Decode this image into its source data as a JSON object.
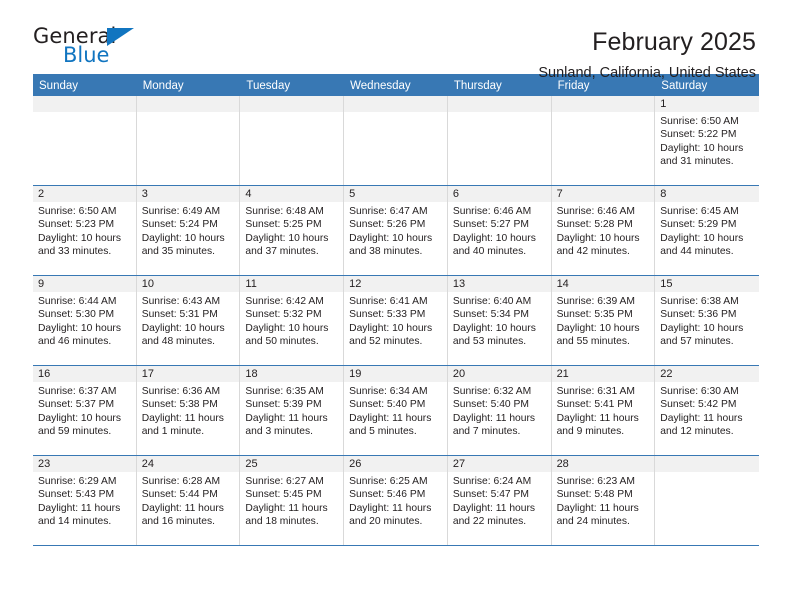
{
  "brand": {
    "name_part1": "General",
    "name_part2": "Blue",
    "triangle_color": "#1175c0"
  },
  "header": {
    "title": "February 2025",
    "subtitle": "Sunland, California, United States"
  },
  "theme": {
    "header_blue": "#3878b4",
    "day_strip_gray": "#f1f1f1",
    "text_color": "#231f20",
    "cell_border": "#d9d9d9"
  },
  "weekdays": [
    "Sunday",
    "Monday",
    "Tuesday",
    "Wednesday",
    "Thursday",
    "Friday",
    "Saturday"
  ],
  "weeks": [
    [
      {
        "day": "",
        "empty": true
      },
      {
        "day": "",
        "empty": true
      },
      {
        "day": "",
        "empty": true
      },
      {
        "day": "",
        "empty": true
      },
      {
        "day": "",
        "empty": true
      },
      {
        "day": "",
        "empty": true
      },
      {
        "day": "1",
        "sunrise": "Sunrise: 6:50 AM",
        "sunset": "Sunset: 5:22 PM",
        "daylight": "Daylight: 10 hours and 31 minutes."
      }
    ],
    [
      {
        "day": "2",
        "sunrise": "Sunrise: 6:50 AM",
        "sunset": "Sunset: 5:23 PM",
        "daylight": "Daylight: 10 hours and 33 minutes."
      },
      {
        "day": "3",
        "sunrise": "Sunrise: 6:49 AM",
        "sunset": "Sunset: 5:24 PM",
        "daylight": "Daylight: 10 hours and 35 minutes."
      },
      {
        "day": "4",
        "sunrise": "Sunrise: 6:48 AM",
        "sunset": "Sunset: 5:25 PM",
        "daylight": "Daylight: 10 hours and 37 minutes."
      },
      {
        "day": "5",
        "sunrise": "Sunrise: 6:47 AM",
        "sunset": "Sunset: 5:26 PM",
        "daylight": "Daylight: 10 hours and 38 minutes."
      },
      {
        "day": "6",
        "sunrise": "Sunrise: 6:46 AM",
        "sunset": "Sunset: 5:27 PM",
        "daylight": "Daylight: 10 hours and 40 minutes."
      },
      {
        "day": "7",
        "sunrise": "Sunrise: 6:46 AM",
        "sunset": "Sunset: 5:28 PM",
        "daylight": "Daylight: 10 hours and 42 minutes."
      },
      {
        "day": "8",
        "sunrise": "Sunrise: 6:45 AM",
        "sunset": "Sunset: 5:29 PM",
        "daylight": "Daylight: 10 hours and 44 minutes."
      }
    ],
    [
      {
        "day": "9",
        "sunrise": "Sunrise: 6:44 AM",
        "sunset": "Sunset: 5:30 PM",
        "daylight": "Daylight: 10 hours and 46 minutes."
      },
      {
        "day": "10",
        "sunrise": "Sunrise: 6:43 AM",
        "sunset": "Sunset: 5:31 PM",
        "daylight": "Daylight: 10 hours and 48 minutes."
      },
      {
        "day": "11",
        "sunrise": "Sunrise: 6:42 AM",
        "sunset": "Sunset: 5:32 PM",
        "daylight": "Daylight: 10 hours and 50 minutes."
      },
      {
        "day": "12",
        "sunrise": "Sunrise: 6:41 AM",
        "sunset": "Sunset: 5:33 PM",
        "daylight": "Daylight: 10 hours and 52 minutes."
      },
      {
        "day": "13",
        "sunrise": "Sunrise: 6:40 AM",
        "sunset": "Sunset: 5:34 PM",
        "daylight": "Daylight: 10 hours and 53 minutes."
      },
      {
        "day": "14",
        "sunrise": "Sunrise: 6:39 AM",
        "sunset": "Sunset: 5:35 PM",
        "daylight": "Daylight: 10 hours and 55 minutes."
      },
      {
        "day": "15",
        "sunrise": "Sunrise: 6:38 AM",
        "sunset": "Sunset: 5:36 PM",
        "daylight": "Daylight: 10 hours and 57 minutes."
      }
    ],
    [
      {
        "day": "16",
        "sunrise": "Sunrise: 6:37 AM",
        "sunset": "Sunset: 5:37 PM",
        "daylight": "Daylight: 10 hours and 59 minutes."
      },
      {
        "day": "17",
        "sunrise": "Sunrise: 6:36 AM",
        "sunset": "Sunset: 5:38 PM",
        "daylight": "Daylight: 11 hours and 1 minute."
      },
      {
        "day": "18",
        "sunrise": "Sunrise: 6:35 AM",
        "sunset": "Sunset: 5:39 PM",
        "daylight": "Daylight: 11 hours and 3 minutes."
      },
      {
        "day": "19",
        "sunrise": "Sunrise: 6:34 AM",
        "sunset": "Sunset: 5:40 PM",
        "daylight": "Daylight: 11 hours and 5 minutes."
      },
      {
        "day": "20",
        "sunrise": "Sunrise: 6:32 AM",
        "sunset": "Sunset: 5:40 PM",
        "daylight": "Daylight: 11 hours and 7 minutes."
      },
      {
        "day": "21",
        "sunrise": "Sunrise: 6:31 AM",
        "sunset": "Sunset: 5:41 PM",
        "daylight": "Daylight: 11 hours and 9 minutes."
      },
      {
        "day": "22",
        "sunrise": "Sunrise: 6:30 AM",
        "sunset": "Sunset: 5:42 PM",
        "daylight": "Daylight: 11 hours and 12 minutes."
      }
    ],
    [
      {
        "day": "23",
        "sunrise": "Sunrise: 6:29 AM",
        "sunset": "Sunset: 5:43 PM",
        "daylight": "Daylight: 11 hours and 14 minutes."
      },
      {
        "day": "24",
        "sunrise": "Sunrise: 6:28 AM",
        "sunset": "Sunset: 5:44 PM",
        "daylight": "Daylight: 11 hours and 16 minutes."
      },
      {
        "day": "25",
        "sunrise": "Sunrise: 6:27 AM",
        "sunset": "Sunset: 5:45 PM",
        "daylight": "Daylight: 11 hours and 18 minutes."
      },
      {
        "day": "26",
        "sunrise": "Sunrise: 6:25 AM",
        "sunset": "Sunset: 5:46 PM",
        "daylight": "Daylight: 11 hours and 20 minutes."
      },
      {
        "day": "27",
        "sunrise": "Sunrise: 6:24 AM",
        "sunset": "Sunset: 5:47 PM",
        "daylight": "Daylight: 11 hours and 22 minutes."
      },
      {
        "day": "28",
        "sunrise": "Sunrise: 6:23 AM",
        "sunset": "Sunset: 5:48 PM",
        "daylight": "Daylight: 11 hours and 24 minutes."
      },
      {
        "day": "",
        "empty": true
      }
    ]
  ]
}
